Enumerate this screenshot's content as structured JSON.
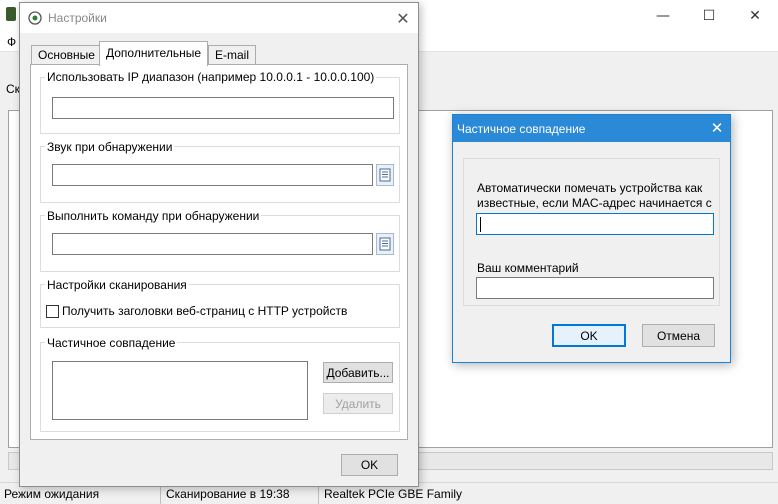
{
  "main_window": {
    "menu_first": "Ф",
    "side_label": "Ск",
    "status": {
      "state": "Режим ожидания",
      "scan": "Сканирование в 19:38",
      "adapter": "Realtek PCIe GBE Family"
    },
    "caption_icons": {
      "minimize": "—",
      "maximize": "☐",
      "close": "✕"
    }
  },
  "settings_dialog": {
    "title": "Настройки",
    "close_glyph": "✕",
    "tabs": [
      "Основные",
      "Дополнительные",
      "E-mail"
    ],
    "active_tab": "Дополнительные",
    "ip_range": {
      "label": "Использовать IP диапазон (например 10.0.0.1 - 10.0.0.100)",
      "value": ""
    },
    "sound": {
      "label": "Звук при обнаружении",
      "value": ""
    },
    "command": {
      "label": "Выполнить команду при обнаружении",
      "value": ""
    },
    "scan_settings": {
      "label": "Настройки сканирования",
      "checkbox_label": "Получить заголовки веб-страниц с HTTP устройств",
      "checked": false
    },
    "partial_match": {
      "label": "Частичное совпадение",
      "items": [],
      "add_button": "Добавить...",
      "delete_button": "Удалить"
    },
    "ok_button": "OK"
  },
  "partial_match_dialog": {
    "title": "Частичное совпадение",
    "close_glyph": "✕",
    "prompt_line1": "Автоматически помечать устройства как",
    "prompt_line2": "известные, если MAC-адрес начинается с",
    "mac_value": "",
    "comment_label": "Ваш комментарий",
    "comment_value": "",
    "ok_button": "OK",
    "cancel_button": "Отмена"
  },
  "colors": {
    "accent": "#0078d7",
    "title_active": "#2b8ad8",
    "dialog_bg": "#f0f0f0"
  }
}
